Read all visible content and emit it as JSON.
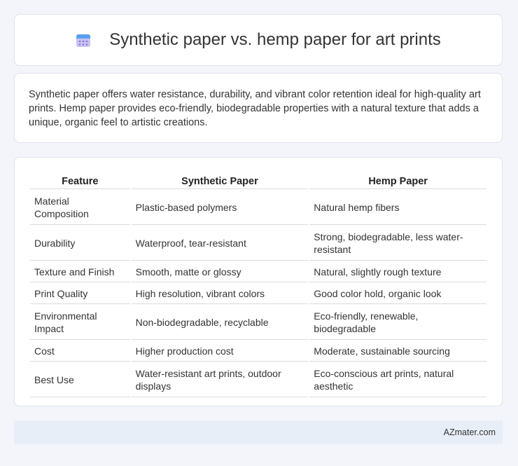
{
  "header": {
    "title": "Synthetic paper vs. hemp paper for art prints",
    "icon": "calendar-icon"
  },
  "summary": {
    "text": "Synthetic paper offers water resistance, durability, and vibrant color retention ideal for high-quality art prints. Hemp paper provides eco-friendly, biodegradable properties with a natural texture that adds a unique, organic feel to artistic creations."
  },
  "table": {
    "headers": [
      "Feature",
      "Synthetic Paper",
      "Hemp Paper"
    ],
    "rows": [
      [
        "Material Composition",
        "Plastic-based polymers",
        "Natural hemp fibers"
      ],
      [
        "Durability",
        "Waterproof, tear-resistant",
        "Strong, biodegradable, less water-resistant"
      ],
      [
        "Texture and Finish",
        "Smooth, matte or glossy",
        "Natural, slightly rough texture"
      ],
      [
        "Print Quality",
        "High resolution, vibrant colors",
        "Good color hold, organic look"
      ],
      [
        "Environmental Impact",
        "Non-biodegradable, recyclable",
        "Eco-friendly, renewable, biodegradable"
      ],
      [
        "Cost",
        "Higher production cost",
        "Moderate, sustainable sourcing"
      ],
      [
        "Best Use",
        "Water-resistant art prints, outdoor displays",
        "Eco-conscious art prints, natural aesthetic"
      ]
    ]
  },
  "footer": {
    "text": "AZmater.com"
  }
}
